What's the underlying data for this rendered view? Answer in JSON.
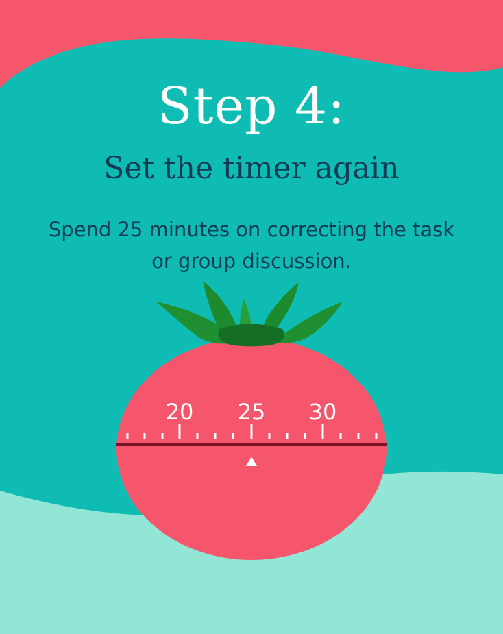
{
  "heading": {
    "title": "Step 4:",
    "subtitle": "Set the timer again",
    "description": "Spend 25 minutes on correcting the task or group discussion."
  },
  "timer": {
    "labels": [
      "20",
      "25",
      "30"
    ],
    "selected": "25"
  },
  "colors": {
    "background_teal": "#0fbcb4",
    "top_wave": "#f6566b",
    "bottom_wave": "#92e6d6",
    "tomato": "#f5566b",
    "leaves": "#1d8a2e",
    "text_dark": "#133c52",
    "line_dark": "#7a1226"
  }
}
